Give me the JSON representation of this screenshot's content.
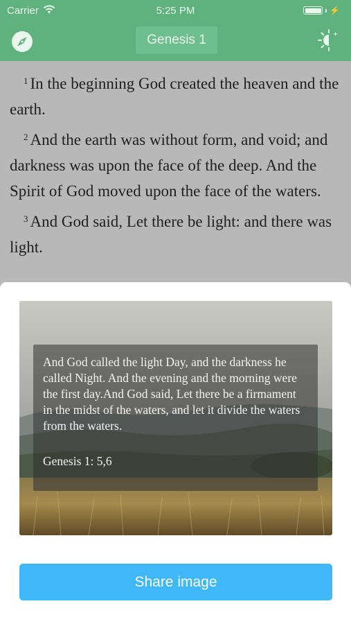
{
  "status_bar": {
    "carrier": "Carrier",
    "time": "5:25 PM"
  },
  "nav": {
    "title": "Genesis 1",
    "left_icon": "compass-icon",
    "right_icon": "night-mode-icon",
    "color": "#5fb27e"
  },
  "verses": [
    {
      "number": "1",
      "text": "In the beginning God created the heaven and the earth."
    },
    {
      "number": "2",
      "text": "And the earth was without form, and void; and darkness was upon the face of the deep. And the Spirit of God moved upon the face of the waters."
    },
    {
      "number": "3",
      "text": "And God said, Let there be light: and there was light."
    }
  ],
  "share_sheet": {
    "quote": "And God called the light Day, and the darkness he called Night. And the evening and the morning were the first day.And God said, Let there be a firmament in the midst of the waters, and let it divide the waters from the waters.",
    "reference": "Genesis 1: 5,6",
    "button_label": "Share image",
    "button_color": "#40b8f8"
  }
}
